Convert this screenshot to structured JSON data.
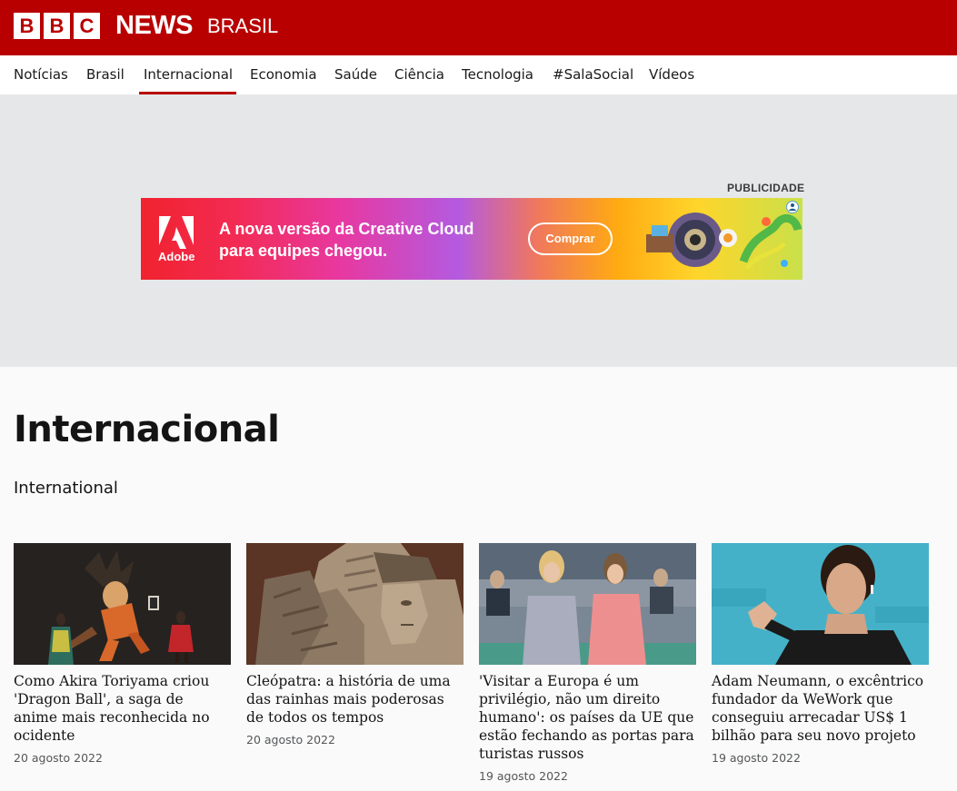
{
  "header": {
    "logo_letters": [
      "B",
      "B",
      "C"
    ],
    "news": "NEWS",
    "edition": "BRASIL"
  },
  "nav": {
    "items": [
      {
        "label": "Notícias",
        "active": false
      },
      {
        "label": "Brasil",
        "active": false
      },
      {
        "label": "Internacional",
        "active": true
      },
      {
        "label": "Economia",
        "active": false
      },
      {
        "label": "Saúde",
        "active": false
      },
      {
        "label": "Ciência",
        "active": false
      },
      {
        "label": "Tecnologia",
        "active": false
      },
      {
        "label": "#SalaSocial",
        "active": false
      },
      {
        "label": "Vídeos",
        "active": false
      }
    ]
  },
  "ad": {
    "label": "PUBLICIDADE",
    "brand": "Adobe",
    "headline_line1": "A nova versão da Creative Cloud",
    "headline_line2": "para equipes chegou.",
    "button": "Comprar"
  },
  "page": {
    "title": "Internacional",
    "subtitle": "International"
  },
  "articles": [
    {
      "headline": "Como Akira Toriyama criou 'Dragon Ball', a saga de anime mais reconhecida no ocidente",
      "date": "20 agosto 2022"
    },
    {
      "headline": "Cleópatra: a história de uma das rainhas mais poderosas de todos os tempos",
      "date": "20 agosto 2022"
    },
    {
      "headline": "'Visitar a Europa é um privilégio, não um direito humano': os países da UE que estão fechando as portas para turistas russos",
      "date": "19 agosto 2022"
    },
    {
      "headline": "Adam Neumann, o excêntrico fundador da WeWork que conseguiu arrecadar US$ 1 bilhão para seu novo projeto",
      "date": "19 agosto 2022"
    }
  ],
  "colors": {
    "brand_red": "#b80000",
    "ad_background": "#e6e7e9",
    "date_gray": "#545658"
  }
}
